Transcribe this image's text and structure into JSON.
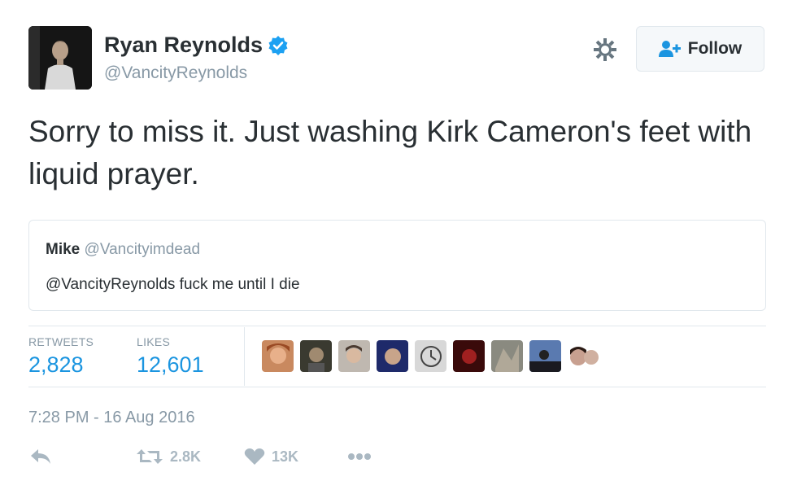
{
  "user": {
    "name": "Ryan Reynolds",
    "handle": "@VancityReynolds",
    "verified_icon": "verified-badge-icon"
  },
  "follow": {
    "label": "Follow",
    "icon": "follow-user-icon"
  },
  "tweet": {
    "text": "Sorry to miss it. Just washing Kirk Cameron's feet with liquid prayer."
  },
  "quote": {
    "name": "Mike",
    "handle": "@Vancityimdead",
    "text": "@VancityReynolds fuck me until I die"
  },
  "stats": {
    "retweets_label": "RETWEETS",
    "retweets_value": "2,828",
    "likes_label": "LIKES",
    "likes_value": "12,601"
  },
  "timestamp": "7:28 PM - 16 Aug 2016",
  "actions": {
    "retweet_count": "2.8K",
    "like_count": "13K"
  },
  "colors": {
    "accent": "#1b95e0",
    "muted": "#8899a6",
    "border": "#e1e8ed"
  }
}
